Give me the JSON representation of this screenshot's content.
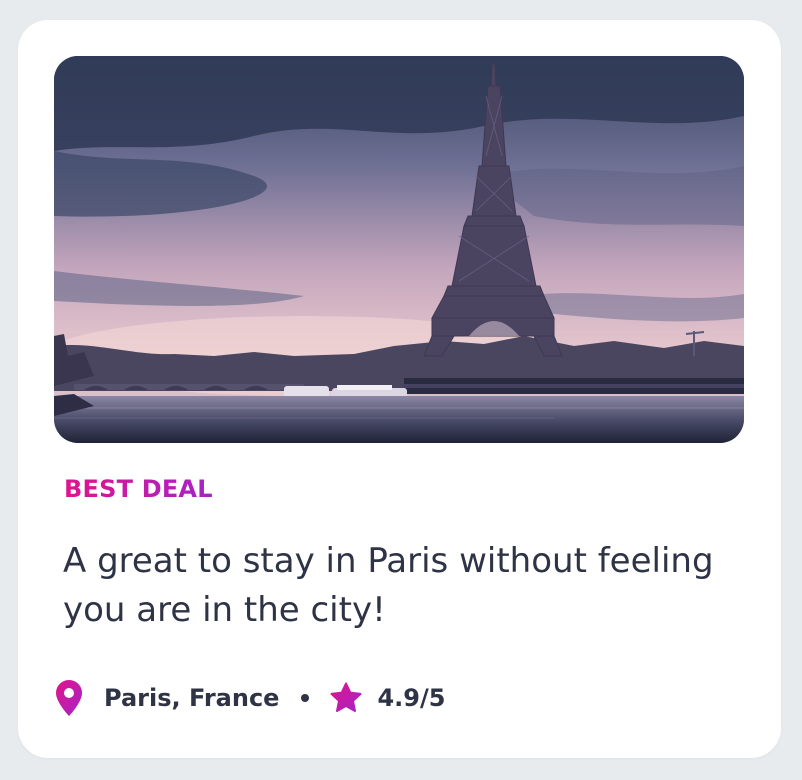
{
  "card": {
    "image_alt": "Eiffel Tower at dusk over the Seine",
    "badge": "BEST DEAL",
    "headline": "A great to stay in Paris without feeling you are in the city!",
    "location": "Paris, France",
    "rating": "4.9/5"
  },
  "icons": {
    "location": "map-pin-icon",
    "rating": "star-icon",
    "separator": "bullet-dot"
  },
  "colors": {
    "background": "#e8ebee",
    "card": "#ffffff",
    "text": "#2e3346",
    "accent_start": "#e0148c",
    "accent_end": "#a524c6"
  }
}
